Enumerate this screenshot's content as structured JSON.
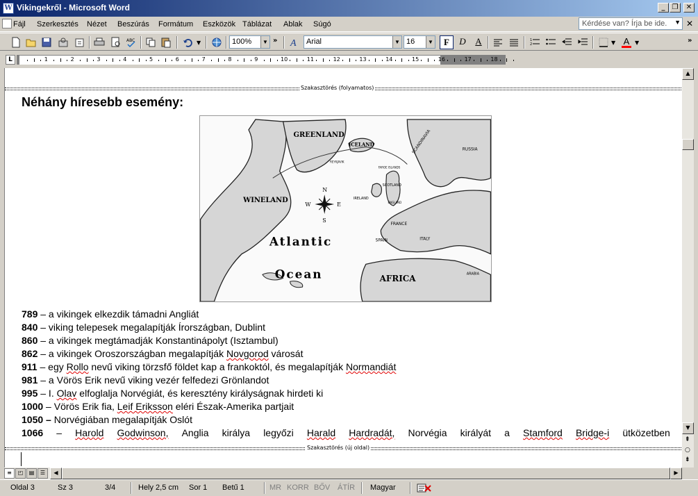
{
  "window": {
    "title": "Vikingekről - Microsoft Word",
    "minimize": "_",
    "restore": "❐",
    "close": "✕"
  },
  "menu": {
    "items": [
      "Fájl",
      "Szerkesztés",
      "Nézet",
      "Beszúrás",
      "Formátum",
      "Eszközök",
      "Táblázat",
      "Ablak",
      "Súgó"
    ],
    "help_placeholder": "Kérdése van? Írja be ide."
  },
  "toolbar": {
    "zoom": "100%",
    "font": "Arial",
    "font_size": "16",
    "bold_label": "F",
    "italic_label": "D",
    "underline_label": "A",
    "font_color": "#ff0000"
  },
  "ruler": {
    "numbers": [
      "1",
      "2",
      "3",
      "4",
      "5",
      "6",
      "7",
      "8",
      "9",
      "10",
      "11",
      "12",
      "13",
      "14",
      "15",
      "16",
      "17",
      "18"
    ]
  },
  "document": {
    "section_break_top": "Szakasztörés (folyamatos)",
    "heading": "Néhány híresebb esemény:",
    "map": {
      "labels": {
        "greenland": "GREENLAND",
        "iceland": "ICELAND",
        "wineland": "WINELAND",
        "atlantic": "Atlantic",
        "ocean": "Ocean",
        "africa": "AFRICA",
        "ireland": "IRELAND",
        "scotland": "SCOTLAND",
        "france": "FRANCE",
        "spain": "SPAIN",
        "italy": "ITALY",
        "arabia": "ARABIA",
        "reykjavik": "REYKJAVIK",
        "faroe": "FAROE ISLANDS",
        "n": "N",
        "s": "S",
        "w": "W",
        "e": "E",
        "scandinavia": "SCANDINAVIA",
        "russia": "RUSSIA",
        "england": "ENGLAND"
      }
    },
    "events": [
      {
        "year": "789",
        "sep": " –",
        "text": " a vikingek elkezdik támadni Angliát"
      },
      {
        "year": "840",
        "sep": " –",
        "text": " viking telepesek megalapítják Írországban, Dublint"
      },
      {
        "year": "860",
        "sep": " –",
        "text": " a vikingek megtámadják Konstantinápolyt (Isztambul)"
      },
      {
        "year": "862",
        "sep": " –",
        "text_before": " a vikingek Oroszországban megalapítják ",
        "spell": "Novgorod",
        "text_after": " városát"
      },
      {
        "year": "911",
        "sep": " –",
        "text_before": " egy ",
        "spell": "Rollo",
        "text_mid": " nevű viking törzsfő földet kap a frankoktól, és megalapítják ",
        "spell2": "Normandiát",
        "text_after": ""
      },
      {
        "year": "981",
        "sep": " –",
        "text": " a Vörös Erik nevű viking vezér felfedezi Grönlandot"
      },
      {
        "year": "995",
        "sep": " –",
        "text_before": " I. ",
        "spell": "Olav",
        "text_after": " elfoglalja Norvégiát, és keresztény királyságnak hirdeti ki"
      },
      {
        "year": "1000",
        "sep": " –",
        "text_before": " Vörös Erik fia, ",
        "spell": "Leif Eriksson",
        "text_after": " eléri Észak-Amerika partjait"
      },
      {
        "year": "1050",
        "sep": " –",
        "text": " Norvégiában megalapítják Oslót"
      }
    ],
    "last_event": {
      "year": "1066",
      "words": [
        "–",
        "Harold",
        "Godwinson,",
        "Anglia",
        "királya",
        "legyőzi",
        "Harald",
        "Hardradát,",
        "Norvégia",
        "királyát",
        "a",
        "Stamford",
        "Bridge-i",
        "ütközetben"
      ]
    },
    "section_break_bottom": "Szakasztörés (új oldal)"
  },
  "status": {
    "page": "Oldal 3",
    "section": "Sz 3",
    "pages": "3/4",
    "position": "Hely 2,5 cm",
    "line": "Sor 1",
    "column": "Betű 1",
    "rec": "MR",
    "trk": "KORR",
    "ext": "BŐV",
    "ovr": "ÁTÍR",
    "language": "Magyar"
  }
}
